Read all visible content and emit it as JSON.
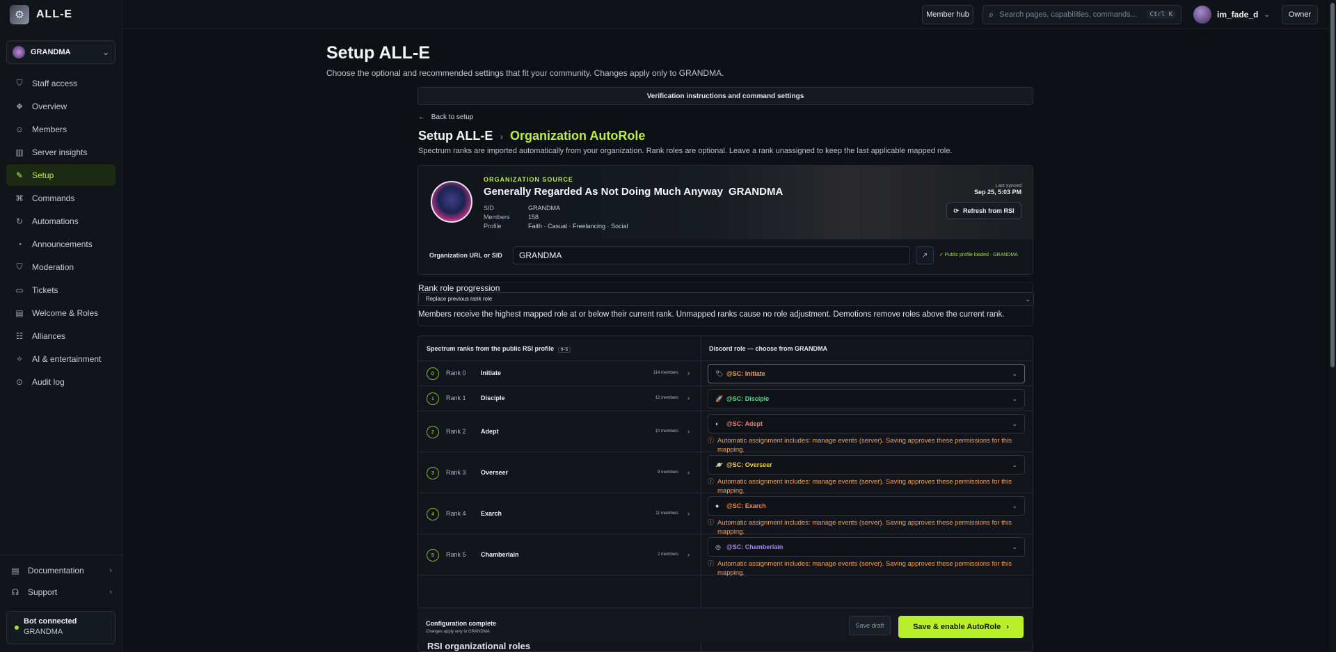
{
  "brand": {
    "name": "ALL-E"
  },
  "guild": {
    "name": "GRANDMA"
  },
  "nav": [
    {
      "label": "Staff access",
      "icon": "shield-icon",
      "glyph": "⛉",
      "active": false
    },
    {
      "label": "Overview",
      "icon": "overview-icon",
      "glyph": "❖",
      "active": false
    },
    {
      "label": "Members",
      "icon": "members-icon",
      "glyph": "☺",
      "active": false
    },
    {
      "label": "Server insights",
      "icon": "chart-icon",
      "glyph": "▥",
      "active": false
    },
    {
      "label": "Setup",
      "icon": "wrench-icon",
      "glyph": "✎",
      "active": true
    },
    {
      "label": "Commands",
      "icon": "command-icon",
      "glyph": "⌘",
      "active": false
    },
    {
      "label": "Automations",
      "icon": "automation-icon",
      "glyph": "↻",
      "active": false
    },
    {
      "label": "Announcements",
      "icon": "megaphone-icon",
      "glyph": "◔",
      "active": false
    },
    {
      "label": "Moderation",
      "icon": "shield-check-icon",
      "glyph": "⛉",
      "active": false
    },
    {
      "label": "Tickets",
      "icon": "ticket-icon",
      "glyph": "▭",
      "active": false
    },
    {
      "label": "Welcome & Roles",
      "icon": "book-icon",
      "glyph": "▤",
      "active": false
    },
    {
      "label": "Alliances",
      "icon": "handshake-icon",
      "glyph": "☷",
      "active": false
    },
    {
      "label": "AI & entertainment",
      "icon": "sparkle-icon",
      "glyph": "✧",
      "active": false
    },
    {
      "label": "Audit log",
      "icon": "audit-icon",
      "glyph": "⊙",
      "active": false
    }
  ],
  "sidebar_bottom": {
    "documentation": "Documentation",
    "support": "Support",
    "bot_status": "Bot connected",
    "bot_guild": "GRANDMA"
  },
  "topbar": {
    "member_hub": "Member hub",
    "search_placeholder": "Search pages, capabilities, commands...",
    "shortcut": "Ctrl K",
    "username": "im_fade_d",
    "role": "Owner"
  },
  "page": {
    "title": "Setup ALL-E",
    "subtitle": "Choose the optional and recommended settings that fit your community. Changes apply only to GRANDMA.",
    "section_bar": "Verification instructions and command settings",
    "back": "Back to setup",
    "crumb_root": "Setup ALL-E",
    "crumb_current": "Organization AutoRole",
    "description": "Spectrum ranks are imported automatically from your organization. Rank roles are optional. Leave a rank unassigned to keep the last applicable mapped role."
  },
  "org": {
    "kicker": "ORGANIZATION SOURCE",
    "name": "Generally Regarded As Not Doing Much Anyway",
    "tag": "GRANDMA",
    "sid_label": "SID",
    "sid": "GRANDMA",
    "members_label": "Members",
    "members": "158",
    "profile_label": "Profile",
    "profile": "Faith · Casual · Freelancing · Social",
    "last_synced_label": "Last synced",
    "last_synced": "Sep 25, 5:03 PM",
    "refresh": "Refresh from RSI",
    "url_label": "Organization URL or SID",
    "url_value": "GRANDMA",
    "loaded": "✓ Public profile loaded · GRANDMA"
  },
  "progression": {
    "title": "Rank role progression",
    "mode": "Replace previous rank role",
    "note": "Members receive the highest mapped role at or below their current rank. Unmapped ranks cause no role adjustment. Demotions remove roles above the current rank."
  },
  "mapping": {
    "left_header": "Spectrum ranks from the public RSI profile",
    "left_pill": "0–5",
    "right_header": "Discord role — choose from GRANDMA",
    "warning": "Automatic assignment includes: manage events (server). Saving approves these permissions for this mapping.",
    "rows": [
      {
        "num": "0",
        "label": "Rank 0",
        "name": "Initiate",
        "count": "114 members",
        "role": "@SC: Initiate",
        "color": "#f0a05a",
        "icon": "🏷",
        "warn": false
      },
      {
        "num": "1",
        "label": "Rank 1",
        "name": "Disciple",
        "count": "12 members",
        "role": "@SC: Disciple",
        "color": "#4fe08a",
        "icon": "🚀",
        "warn": false
      },
      {
        "num": "2",
        "label": "Rank 2",
        "name": "Adept",
        "count": "10 members",
        "role": "@SC: Adept",
        "color": "#f07a7a",
        "icon": "◐",
        "warn": true
      },
      {
        "num": "3",
        "label": "Rank 3",
        "name": "Overseer",
        "count": "9 members",
        "role": "@SC: Overseer",
        "color": "#f0d14a",
        "icon": "🪐",
        "warn": true
      },
      {
        "num": "4",
        "label": "Rank 4",
        "name": "Exarch",
        "count": "11 members",
        "role": "@SC: Exarch",
        "color": "#f08a4a",
        "icon": "●",
        "warn": true
      },
      {
        "num": "5",
        "label": "Rank 5",
        "name": "Chamberlain",
        "count": "2 members",
        "role": "@SC: Chamberlain",
        "color": "#a98bf0",
        "icon": "◎",
        "warn": true
      }
    ]
  },
  "save_bar": {
    "title": "Configuration complete",
    "sub": "Changes apply only to GRANDMA.",
    "draft": "Save draft",
    "enable": "Save & enable AutoRole"
  },
  "next_section": "RSI organizational roles"
}
